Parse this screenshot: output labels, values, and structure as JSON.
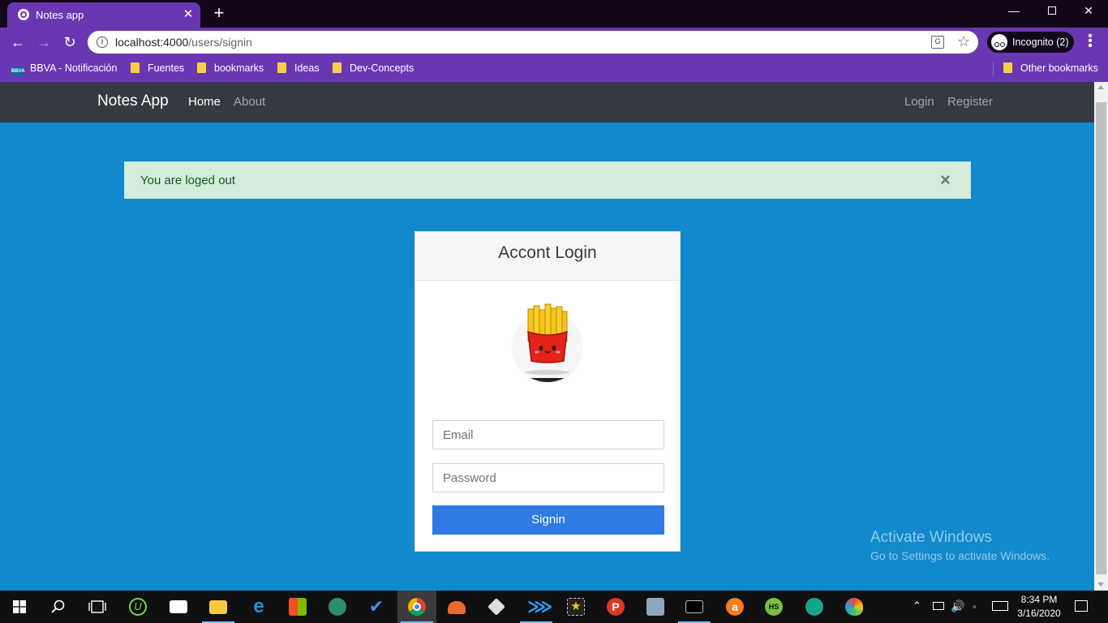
{
  "browser": {
    "tab_title": "Notes app",
    "tab_close": "✕",
    "new_tab": "+",
    "url_host": "localhost:4000",
    "url_path": "/users/signin",
    "incognito_label": "Incognito (2)"
  },
  "bookmarks": [
    {
      "label": "BBVA - Notificación",
      "icon": "bbva-icon"
    },
    {
      "label": "Fuentes",
      "icon": "folder-icon"
    },
    {
      "label": "bookmarks",
      "icon": "folder-icon"
    },
    {
      "label": "Ideas",
      "icon": "folder-icon"
    },
    {
      "label": "Dev-Concepts",
      "icon": "folder-icon"
    }
  ],
  "other_bookmarks": "Other bookmarks",
  "app": {
    "brand": "Notes App",
    "nav_left": [
      "Home",
      "About"
    ],
    "nav_right": [
      "Login",
      "Register"
    ],
    "active_nav": "Home"
  },
  "alert": {
    "message": "You are loged out",
    "close": "×"
  },
  "login_card": {
    "title": "Accont Login",
    "email_placeholder": "Email",
    "password_placeholder": "Password",
    "submit_label": "Signin"
  },
  "watermark": {
    "title": "Activate Windows",
    "subtitle": "Go to Settings to activate Windows."
  },
  "taskbar": {
    "apps": [
      "start-icon",
      "search-icon",
      "task-view-icon",
      "upwork-icon",
      "mail-icon",
      "file-explorer-icon",
      "edge-icon",
      "store-icon",
      "atom-icon",
      "todo-icon",
      "chrome-icon",
      "mega-icon",
      "inkscape-icon",
      "vscode-icon",
      "movie-maker-icon",
      "psiphon-icon",
      "tool-icon",
      "terminal-icon",
      "avast-icon",
      "hotspot-shield-icon",
      "vpn-icon",
      "paint-icon"
    ],
    "active_app": "chrome-icon",
    "time": "8:34 PM",
    "date": "3/16/2020"
  },
  "colors": {
    "page_bg": "#1288cd",
    "browser_accent": "#6a37b3",
    "navbar_bg": "#343a40",
    "alert_bg": "#d4edda",
    "button_bg": "#2f7be3"
  }
}
